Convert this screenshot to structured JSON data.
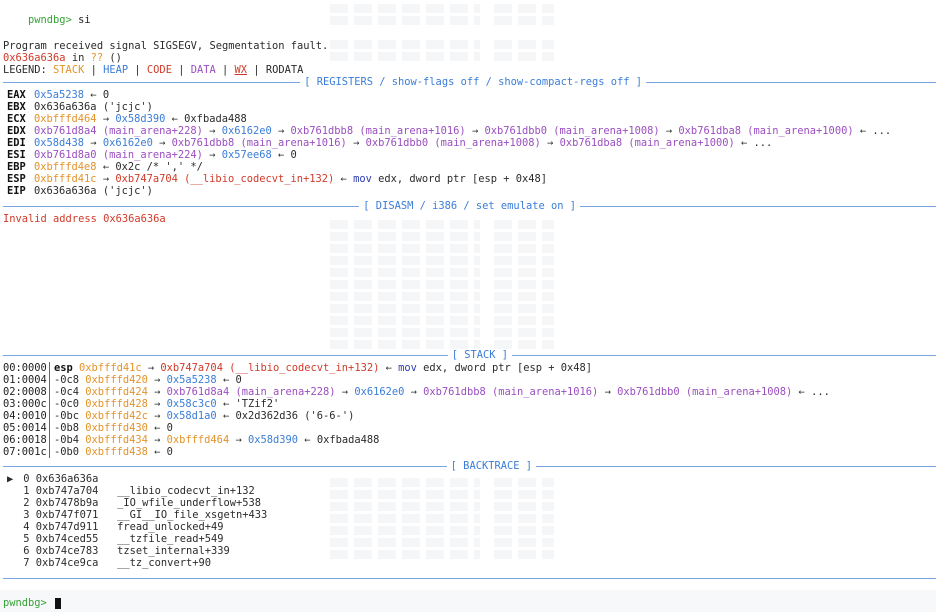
{
  "prompt": {
    "label": "pwndbg>",
    "command": "si"
  },
  "signal": {
    "line1": "Program received signal SIGSEGV, Segmentation fault.",
    "address": "0x636a636a",
    "in": " in ",
    "unknown": "??",
    "paren": " ()"
  },
  "legend": {
    "prefix": "LEGEND: ",
    "stack": "STACK",
    "heap": "HEAP",
    "code": "CODE",
    "data": "DATA",
    "wx": "WX",
    "rodata": "RODATA",
    "sep": " | "
  },
  "headers": {
    "registers": "[ REGISTERS / show-flags off / show-compact-regs off ]",
    "disasm": "[ DISASM / i386 / set emulate on ]",
    "stack": "[ STACK ]",
    "backtrace": "[ BACKTRACE ]"
  },
  "registers": {
    "eax": {
      "name": "EAX",
      "v1": "0x5a5238",
      "arrow": " ← ",
      "v2": "0"
    },
    "ebx": {
      "name": "EBX",
      "v1": "0x636a636a ('jcjc')"
    },
    "ecx": {
      "name": "ECX",
      "v1": "0xbfffd464",
      "a1": " → ",
      "v2": "0x58d390",
      "a2": " ← ",
      "v3": "0xfbada488"
    },
    "edx": {
      "name": "EDX",
      "v1": "0xb761d8a4 (main_arena+228)",
      "a1": " → ",
      "v2": "0x6162e0",
      "a2": " → ",
      "v3": "0xb761dbb8 (main_arena+1016)",
      "a3": " → ",
      "v4": "0xb761dbb0 (main_arena+1008)",
      "a4": " → ",
      "v5": "0xb761dba8 (main_arena+1000)",
      "tail": " ← ..."
    },
    "edi": {
      "name": "EDI",
      "v1": "0x58d438",
      "a1": " → ",
      "v2": "0x6162e0",
      "a2": " → ",
      "v3": "0xb761dbb8 (main_arena+1016)",
      "a3": " → ",
      "v4": "0xb761dbb0 (main_arena+1008)",
      "a4": " → ",
      "v5": "0xb761dba8 (main_arena+1000)",
      "tail": " ← ..."
    },
    "esi": {
      "name": "ESI",
      "v1": "0xb761d8a0 (main_arena+224)",
      "a1": " → ",
      "v2": "0x57ee68",
      "a2": " ← ",
      "v3": "0"
    },
    "ebp": {
      "name": "EBP",
      "v1": "0xbfffd4e8",
      "a1": " ← ",
      "v2": "0x2c /* ',' */"
    },
    "esp": {
      "name": "ESP",
      "v1": "0xbfffd41c",
      "a1": " → ",
      "v2": "0xb747a704 (__libio_codecvt_in+132)",
      "a2": " ← ",
      "ins": "mov",
      "ops": " edx, dword ptr [esp + 0x48]"
    },
    "eip": {
      "name": "EIP",
      "v1": "0x636a636a ('jcjc')"
    }
  },
  "disasm": {
    "error": "Invalid address 0x636a636a"
  },
  "stack": [
    {
      "off": "00:0000",
      "reg": "esp",
      "addr": "0xbfffd41c",
      "rest_code": "0xb747a704 (__libio_codecvt_in+132)",
      "ins": "mov",
      "ops": " edx, dword ptr [esp + 0x48]"
    },
    {
      "off": "01:0004",
      "reg": "-0c8",
      "addr": "0xbfffd420",
      "v1": "0x5a5238",
      "tail": "0"
    },
    {
      "off": "02:0008",
      "reg": "-0c4",
      "addr": "0xbfffd424",
      "v1": "0xb761d8a4 (main_arena+228)",
      "v2": "0x6162e0",
      "v3": "0xb761dbb8 (main_arena+1016)",
      "v4": "0xb761dbb0 (main_arena+1008)",
      "tail": "..."
    },
    {
      "off": "03:000c",
      "reg": "-0c0",
      "addr": "0xbfffd428",
      "v1": "0x58c3c0",
      "tail": "'TZif2'"
    },
    {
      "off": "04:0010",
      "reg": "-0bc",
      "addr": "0xbfffd42c",
      "v1": "0x58d1a0",
      "tail": "0x2d362d36 ('6-6-')"
    },
    {
      "off": "05:0014",
      "reg": "-0b8",
      "addr": "0xbfffd430",
      "tail": "0"
    },
    {
      "off": "06:0018",
      "reg": "-0b4",
      "addr": "0xbfffd434",
      "v1": "0xbfffd464",
      "v2": "0x58d390",
      "tail": "0xfbada488"
    },
    {
      "off": "07:001c",
      "reg": "-0b0",
      "addr": "0xbfffd438",
      "tail": "0"
    }
  ],
  "backtrace": [
    {
      "marker": "▶",
      "idx": "0",
      "addr": "0x636a636a",
      "sym": ""
    },
    {
      "marker": " ",
      "idx": "1",
      "addr": "0xb747a704",
      "sym": "__libio_codecvt_in+132"
    },
    {
      "marker": " ",
      "idx": "2",
      "addr": "0xb7478b9a",
      "sym": "_IO_wfile_underflow+538"
    },
    {
      "marker": " ",
      "idx": "3",
      "addr": "0xb747f071",
      "sym": "__GI__IO_file_xsgetn+433"
    },
    {
      "marker": " ",
      "idx": "4",
      "addr": "0xb747d911",
      "sym": "fread_unlocked+49"
    },
    {
      "marker": " ",
      "idx": "5",
      "addr": "0xb74ced55",
      "sym": "__tzfile_read+549"
    },
    {
      "marker": " ",
      "idx": "6",
      "addr": "0xb74ce783",
      "sym": "tzset_internal+339"
    },
    {
      "marker": " ",
      "idx": "7",
      "addr": "0xb74ce9ca",
      "sym": "__tz_convert+90"
    }
  ],
  "final_prompt": {
    "label": "pwndbg>"
  },
  "colors": {
    "prompt": "#36a136",
    "stack": "#e3932a",
    "heap": "#3b7dd8",
    "code": "#d03a2a",
    "data": "#9b4fc0",
    "header": "#3b7dd8"
  }
}
